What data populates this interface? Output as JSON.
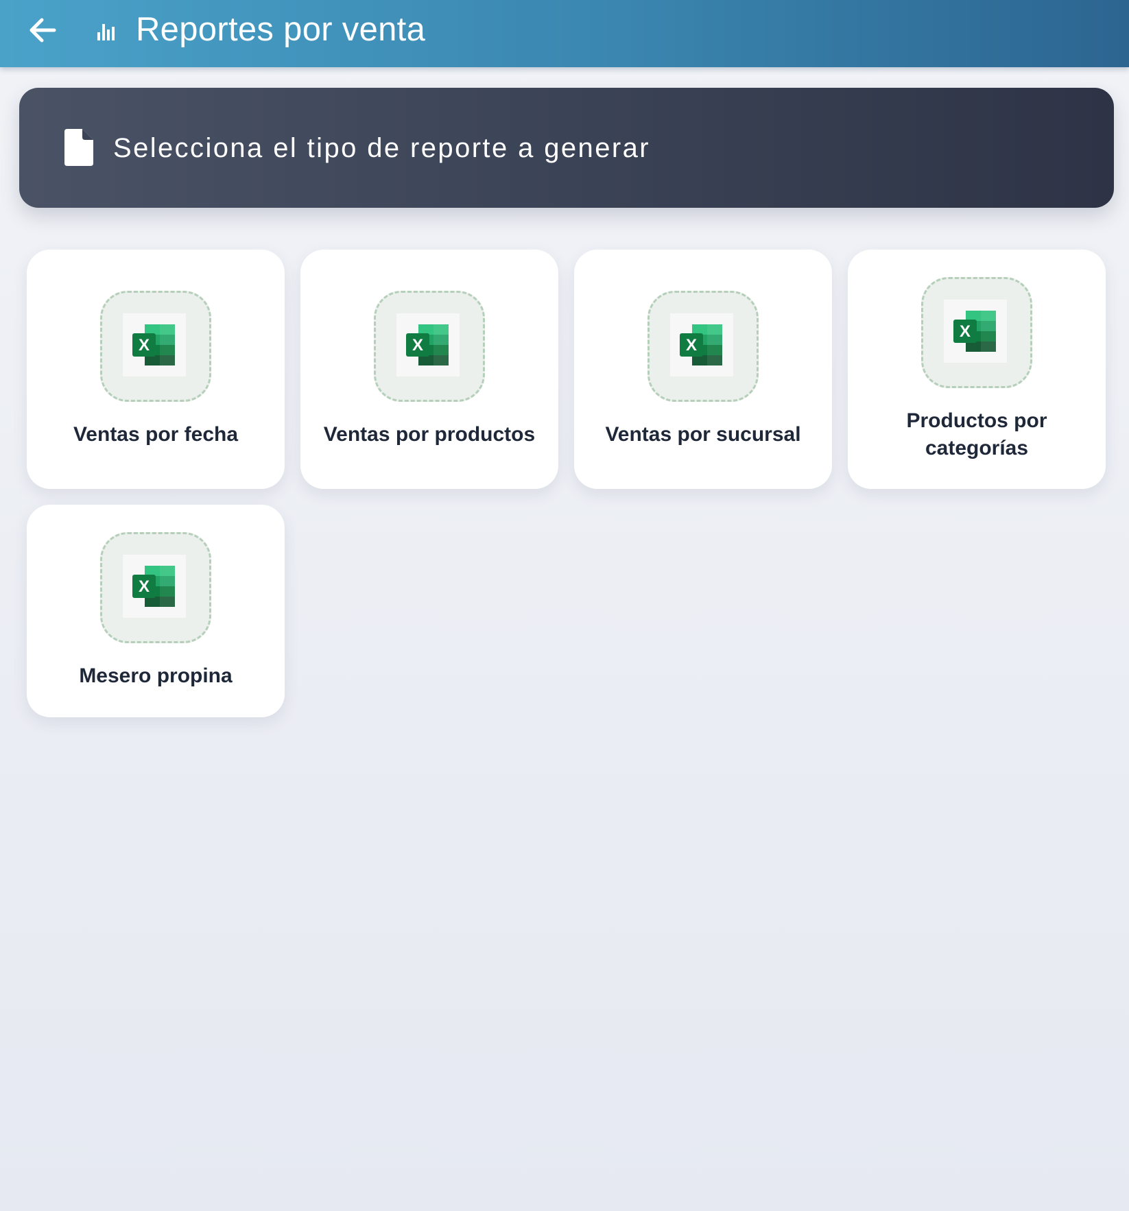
{
  "header": {
    "back_icon": "arrow-left-icon",
    "title_icon": "bar-chart-icon",
    "title": "Reportes por venta"
  },
  "banner": {
    "icon": "document-icon",
    "text": "Selecciona el tipo de reporte a generar"
  },
  "cards": [
    {
      "label": "Ventas por fecha",
      "icon": "excel-icon"
    },
    {
      "label": "Ventas por productos",
      "icon": "excel-icon"
    },
    {
      "label": "Ventas por sucursal",
      "icon": "excel-icon"
    },
    {
      "label": "Productos por categorías",
      "icon": "excel-icon"
    },
    {
      "label": "Mesero propina",
      "icon": "excel-icon"
    }
  ],
  "colors": {
    "header_start": "#4aa2c9",
    "header_end": "#2c6590",
    "banner": "#3b4356",
    "excel_green": "#1e7145"
  }
}
